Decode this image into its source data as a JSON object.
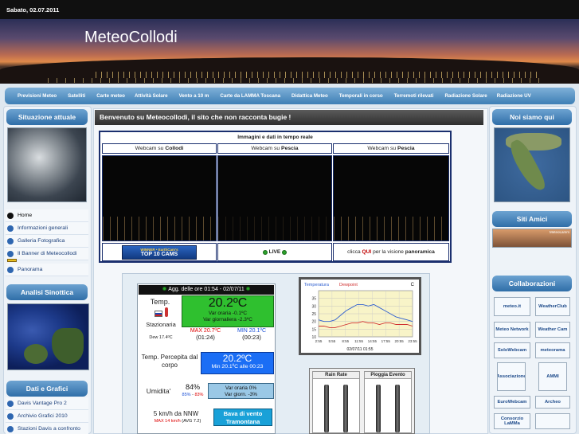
{
  "topbar": {
    "date": "Sabato, 02.07.2011"
  },
  "site": {
    "title": "MeteoCollodi"
  },
  "nav": {
    "items": [
      "Previsioni Meteo",
      "Satelliti",
      "Carte meteo",
      "Attività Solare",
      "Vento a 10 m",
      "Carte da LAMMA Toscana",
      "Didattica Meteo",
      "Temporali in corso",
      "Terremoti rilevati",
      "Radiazione Solare",
      "Radiazione UV"
    ]
  },
  "left": {
    "situazione_title": "Situazione attuale",
    "menu": [
      "Home",
      "Informazioni generali",
      "Galleria Fotografica",
      "Il Banner di Meteocollodi",
      "Panorama"
    ],
    "sinottica_title": "Analisi Sinottica",
    "dati_title": "Dati e Grafici",
    "dati_items": [
      "Davis Vantage Pro 2",
      "Archivio Grafici 2010",
      "Stazioni Davis a confronto"
    ]
  },
  "right": {
    "noi_title": "Noi siamo qui",
    "amici_title": "Siti Amici",
    "friend_label": "MeteoLamm",
    "collab_title": "Collaborazioni",
    "collab_logos": [
      "meteo.it",
      "WeatherClub",
      "Meteo Network",
      "Weather Cam",
      "SoloWebcam",
      "meteorama",
      "Associazione",
      "AMMI",
      "EuroWebcam",
      "Archeo",
      "Consorzio LaMMa",
      ""
    ]
  },
  "main": {
    "welcome": "Benvenuto su Meteocollodi, il sito che non racconta bugie !",
    "webcam_title": "Immagini e dati in tempo reale",
    "cams": [
      {
        "prefix": "Webcam su ",
        "place": "Collodi"
      },
      {
        "prefix": "Webcam su ",
        "place": "Pescia"
      },
      {
        "prefix": "Webcam su ",
        "place": "Pescia"
      }
    ],
    "top10_small": "WINNER • EarthCam's",
    "top10_big": "TOP 10 CAMS",
    "live": "LIVE",
    "click_prefix": "clicca ",
    "click_qui": "QUI",
    "click_mid": " per la visione ",
    "click_bold": "panoramica"
  },
  "weather": {
    "update": "Agg. delle ore 01:54 - 02/07/11",
    "temp_label": "Temp.",
    "stazionaria": "Stazionaria",
    "dew": "Dew 17.4ºC",
    "temp": "20.2ºC",
    "var_oraria": "Var oraria -0.1ºC",
    "var_giornaliera": "Var giornaliera -2.3ºC",
    "max": "MAX 20.7ºC",
    "max_time": "(01:24)",
    "min": "MIN 20.1ºC",
    "min_time": "(00:23)",
    "perc_label": "Temp. Percepita dal corpo",
    "perc_value": "20.2ºC",
    "perc_min": "Min 20.1ºC alle 00:23",
    "umid_label": "Umidita'",
    "umid_value": "84%",
    "umid_range_a": "85%",
    "umid_range_sep": " - ",
    "umid_range_b": "83%",
    "umid_var_oraria": "Var oraria 0%",
    "umid_var_giorn": "Var giorn. -3%",
    "wind_label": "5 km/h da NNW",
    "wind_max": "MAX 14 km/h",
    "wind_avg": "(AVG 7.2)",
    "wind_desc": "Bava di vento Tramontana"
  },
  "chart_data": {
    "type": "line",
    "title": "",
    "legend": [
      "Temperatura",
      "Dewpoint"
    ],
    "unit_label": "C",
    "x": [
      "2:55",
      "5:55",
      "8:55",
      "11:55",
      "14:55",
      "17:55",
      "20:55",
      "23:55"
    ],
    "ylim": [
      10,
      40
    ],
    "yticks": [
      10,
      15,
      20,
      25,
      30,
      35,
      40
    ],
    "date_label": "02/07/11 01:55",
    "series": [
      {
        "name": "Temperatura",
        "color": "#3060d0",
        "values": [
          21,
          20,
          20,
          21,
          24,
          27,
          29,
          31,
          31,
          30,
          31,
          29,
          27,
          25,
          23,
          22,
          21,
          20
        ]
      },
      {
        "name": "Dewpoint",
        "color": "#d03030",
        "values": [
          17,
          17,
          16,
          16,
          17,
          18,
          19,
          19,
          20,
          19,
          19,
          18,
          19,
          19,
          18,
          18,
          18,
          17
        ]
      }
    ]
  },
  "rain": {
    "col1": "Rain Rate",
    "col2": "Pioggia Evento"
  }
}
